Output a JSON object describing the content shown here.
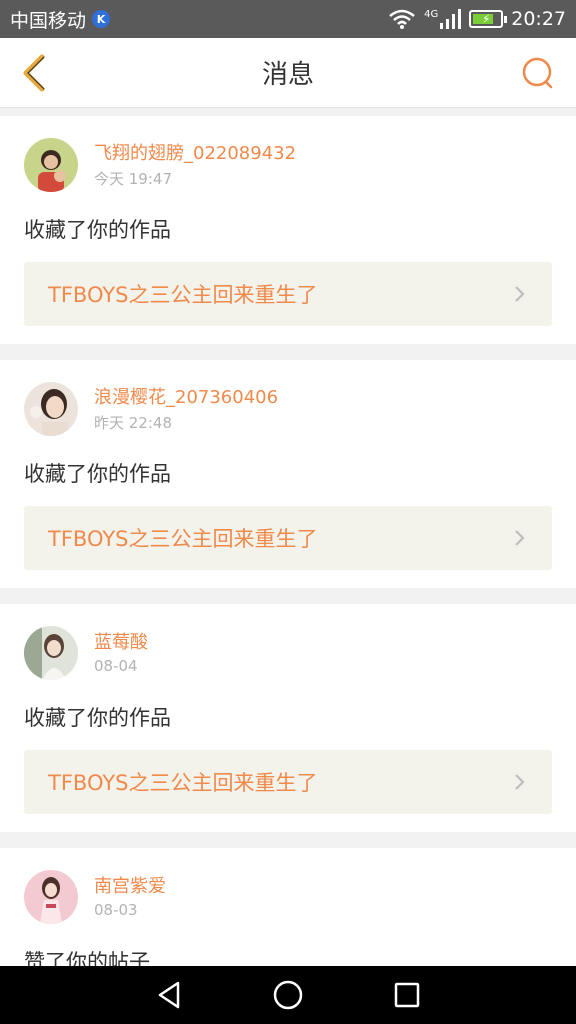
{
  "status_bar": {
    "carrier": "中国移动",
    "carrier_badge": "K",
    "network": "4G",
    "time": "20:27"
  },
  "header": {
    "title": "消息",
    "accent_color": "#f08a4b"
  },
  "messages": [
    {
      "username": "飞翔的翅膀_022089432",
      "time": "今天 19:47",
      "action": "收藏了你的作品",
      "work_title": "TFBOYS之三公主回来重生了",
      "avatar_icon": "avatar-photo"
    },
    {
      "username": "浪漫樱花_207360406",
      "time": "昨天 22:48",
      "action": "收藏了你的作品",
      "work_title": "TFBOYS之三公主回来重生了",
      "avatar_icon": "avatar-photo"
    },
    {
      "username": "蓝莓酸",
      "time": "08-04",
      "action": "收藏了你的作品",
      "work_title": "TFBOYS之三公主回来重生了",
      "avatar_icon": "avatar-photo"
    },
    {
      "username": "南宫紫爱",
      "time": "08-03",
      "action": "赞了你的帖子",
      "avatar_icon": "avatar-photo"
    }
  ]
}
